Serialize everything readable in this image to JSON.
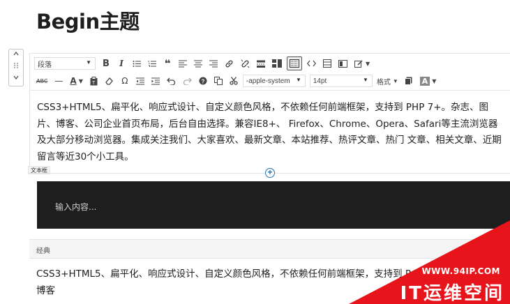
{
  "page": {
    "title": "Begin主题"
  },
  "mover": {
    "up_icon": "chevron-up",
    "drag_icon": "drag-handle",
    "down_icon": "chevron-down"
  },
  "toolbar": {
    "format_select": "段落",
    "font_family_select": "-apple-system",
    "font_size_select": "14pt",
    "formats_menu": "格式",
    "bold": "B",
    "italic": "I",
    "underline_color": "A",
    "bg_color": "A",
    "omega": "Ω",
    "quote": "❝",
    "hr": "—",
    "strike": "ABC"
  },
  "classic_block": {
    "content": "CSS3+HTML5、扁平化、响应式设计、自定义颜色风格，不依赖任何前端框架，支持到 PHP 7+。杂志、图片、博客、公司企业首页布局，后台自由选择。兼容IE8+、 Firefox、Chrome、Opera、Safari等主流浏览器及大部分移动浏览器。集成关注我们、大家喜欢、最新文章、本站推荐、热评文章、热门 文章、相关文章、近期留言等近30个小工具。",
    "tag_label": "文本框"
  },
  "code_block": {
    "placeholder": "输入内容..."
  },
  "classic_bar": {
    "label": "经典"
  },
  "preview": {
    "text": "CSS3+HTML5、扁平化、响应式设计、自定义颜色风格，不依赖任何前端框架，支持到 P",
    "text_line2": "博客"
  },
  "watermark": {
    "url": "WWW.94IP.COM",
    "name": "IT运维空间",
    "color": "#e8141c"
  }
}
